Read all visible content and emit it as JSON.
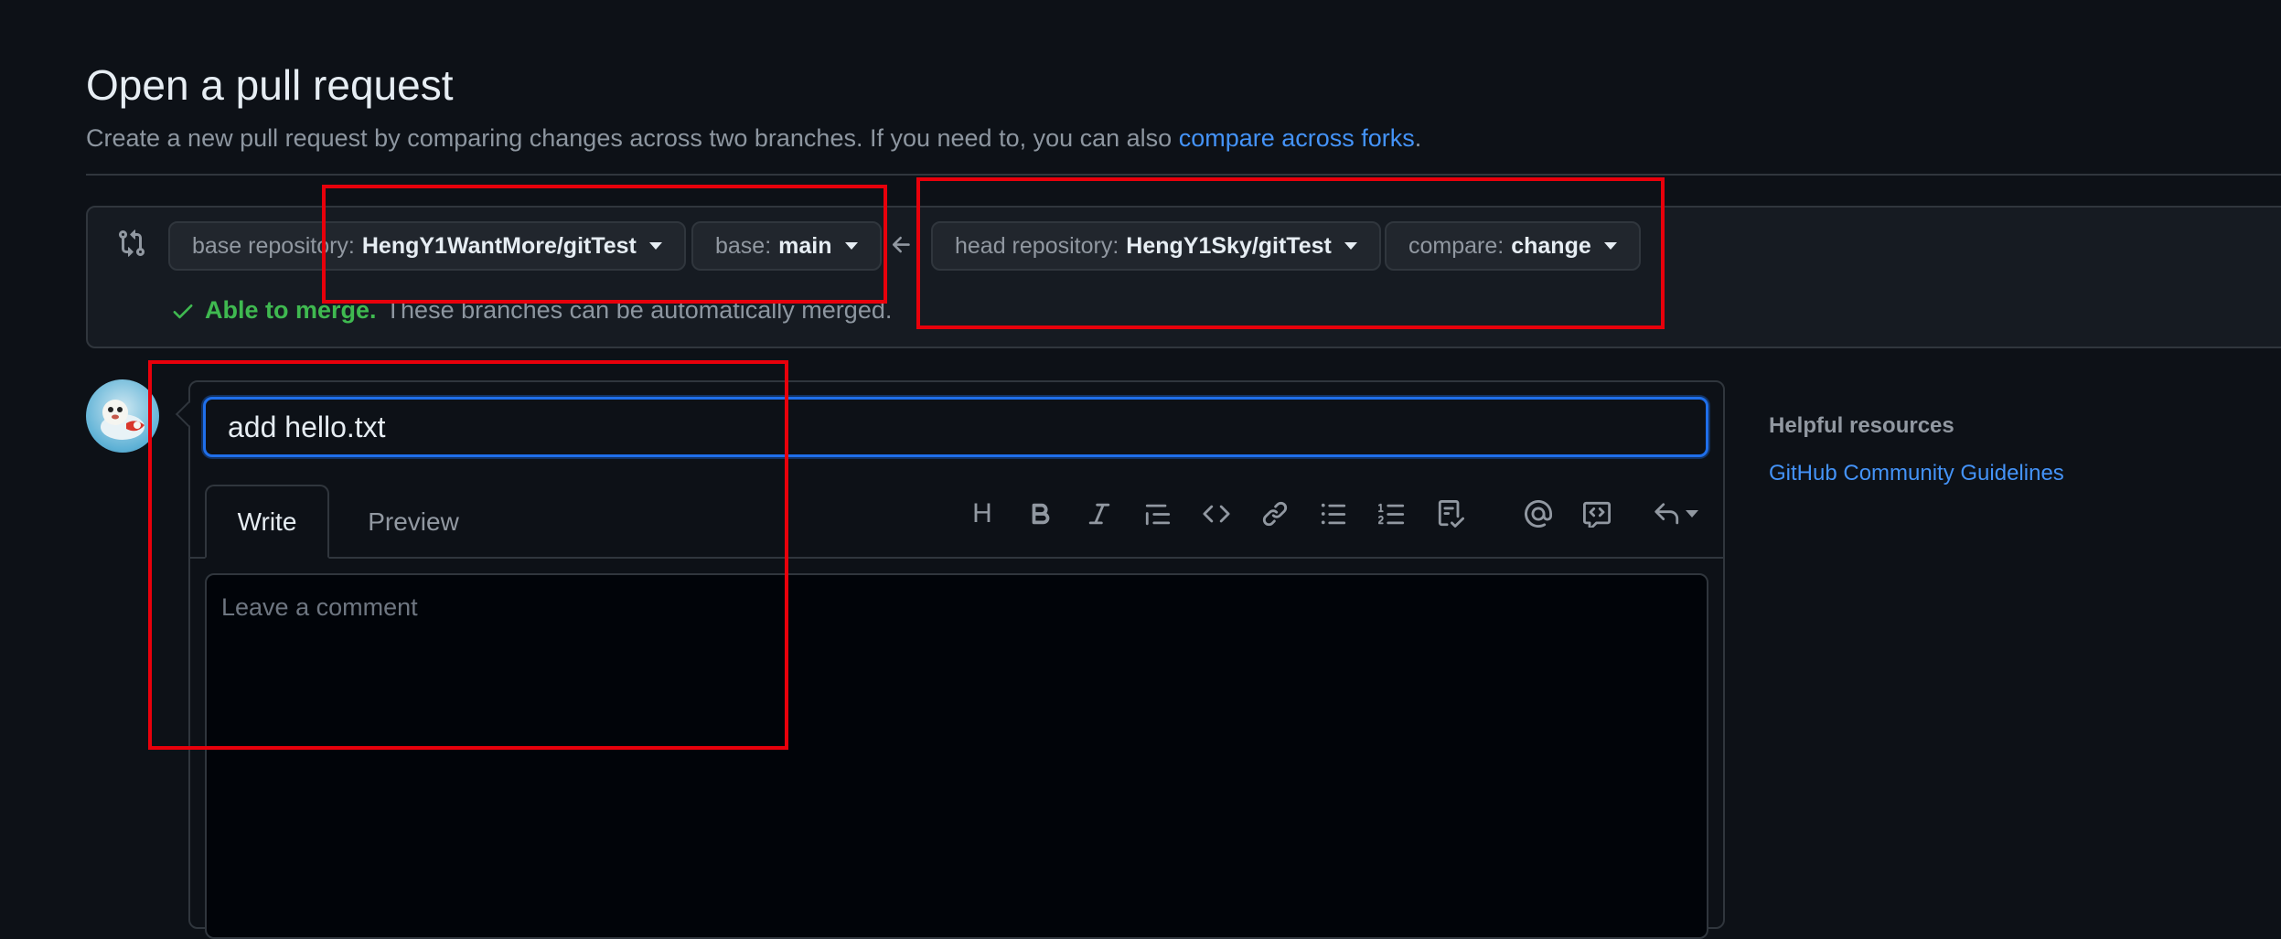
{
  "header": {
    "title": "Open a pull request",
    "subtitle_prefix": "Create a new pull request by comparing changes across two branches. If you need to, you can also ",
    "subtitle_link": "compare across forks",
    "subtitle_suffix": "."
  },
  "compare": {
    "base_repo_label": "base repository:",
    "base_repo_value": "HengY1WantMore/gitTest",
    "base_label": "base:",
    "base_value": "main",
    "head_repo_label": "head repository:",
    "head_repo_value": "HengY1Sky/gitTest",
    "compare_label": "compare:",
    "compare_value": "change",
    "merge_status": "Able to merge.",
    "merge_description": "These branches can be automatically merged."
  },
  "editor": {
    "title_value": "add hello.txt",
    "tabs": [
      "Write",
      "Preview"
    ],
    "comment_placeholder": "Leave a comment",
    "toolbar": [
      "heading-icon",
      "bold-icon",
      "italic-icon",
      "quote-icon",
      "code-icon",
      "link-icon",
      "unordered-list-icon",
      "ordered-list-icon",
      "task-list-icon",
      "mention-icon",
      "reference-icon",
      "saved-replies-icon"
    ],
    "heading_glyph": "H"
  },
  "sidebar": {
    "title": "Helpful resources",
    "link": "GitHub Community Guidelines"
  },
  "colors": {
    "background": "#0d1117",
    "accent_link": "#4493f8",
    "success": "#3fb950",
    "focus_border": "#1f6feb",
    "annotation_red": "#e8000b"
  }
}
